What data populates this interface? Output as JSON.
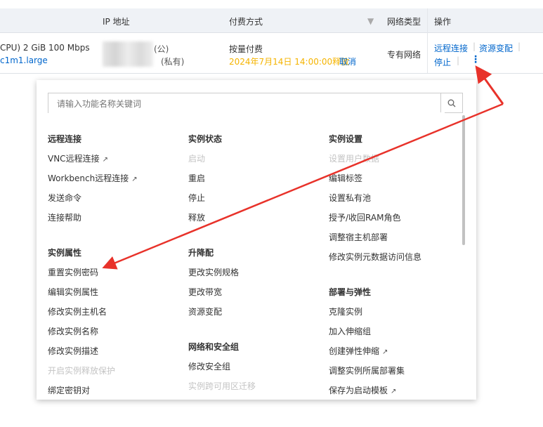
{
  "table": {
    "headers": {
      "ip": "IP 地址",
      "billing": "付费方式",
      "network": "网络类型",
      "actions": "操作"
    },
    "row": {
      "spec": "CPU)  2 GiB 100 Mbps",
      "type": "c1m1.large",
      "ip_public_suffix": "(公)",
      "ip_private_suffix": "(私有)",
      "billing": "按量付费",
      "release": "2024年7月14日 14:00:00释放",
      "cancel": "取消",
      "network": "专有网络",
      "actions": [
        "远程连接",
        "资源变配",
        "停止"
      ]
    }
  },
  "popup": {
    "search_placeholder": "请输入功能名称关键词",
    "col1": [
      {
        "t": "h",
        "l": "远程连接"
      },
      {
        "t": "x",
        "l": "VNC远程连接"
      },
      {
        "t": "x",
        "l": "Workbench远程连接"
      },
      {
        "t": "i",
        "l": "发送命令"
      },
      {
        "t": "i",
        "l": "连接帮助"
      },
      {
        "t": "g"
      },
      {
        "t": "h",
        "l": "实例属性"
      },
      {
        "t": "i",
        "l": "重置实例密码"
      },
      {
        "t": "i",
        "l": "编辑实例属性"
      },
      {
        "t": "i",
        "l": "修改实例主机名"
      },
      {
        "t": "i",
        "l": "修改实例名称"
      },
      {
        "t": "i",
        "l": "修改实例描述"
      },
      {
        "t": "d",
        "l": "开启实例释放保护"
      },
      {
        "t": "i",
        "l": "绑定密钥对"
      }
    ],
    "col2": [
      {
        "t": "h",
        "l": "实例状态"
      },
      {
        "t": "d",
        "l": "启动"
      },
      {
        "t": "i",
        "l": "重启"
      },
      {
        "t": "i",
        "l": "停止"
      },
      {
        "t": "i",
        "l": "释放"
      },
      {
        "t": "g"
      },
      {
        "t": "h",
        "l": "升降配"
      },
      {
        "t": "i",
        "l": "更改实例规格"
      },
      {
        "t": "i",
        "l": "更改带宽"
      },
      {
        "t": "i",
        "l": "资源变配"
      },
      {
        "t": "g"
      },
      {
        "t": "h",
        "l": "网络和安全组"
      },
      {
        "t": "i",
        "l": "修改安全组"
      },
      {
        "t": "d",
        "l": "实例跨可用区迁移"
      }
    ],
    "col3": [
      {
        "t": "h",
        "l": "实例设置"
      },
      {
        "t": "d",
        "l": "设置用户数据"
      },
      {
        "t": "i",
        "l": "编辑标签"
      },
      {
        "t": "i",
        "l": "设置私有池"
      },
      {
        "t": "i",
        "l": "授予/收回RAM角色"
      },
      {
        "t": "i",
        "l": "调整宿主机部署"
      },
      {
        "t": "i",
        "l": "修改实例元数据访问信息"
      },
      {
        "t": "g"
      },
      {
        "t": "h",
        "l": "部署与弹性"
      },
      {
        "t": "i",
        "l": "克隆实例"
      },
      {
        "t": "i",
        "l": "加入伸缩组"
      },
      {
        "t": "x",
        "l": "创建弹性伸缩"
      },
      {
        "t": "i",
        "l": "调整实例所属部署集"
      },
      {
        "t": "x",
        "l": "保存为启动模板"
      }
    ]
  },
  "colors": {
    "link": "#0066cc",
    "warn": "#f5b400",
    "arrow": "#e8322a"
  }
}
